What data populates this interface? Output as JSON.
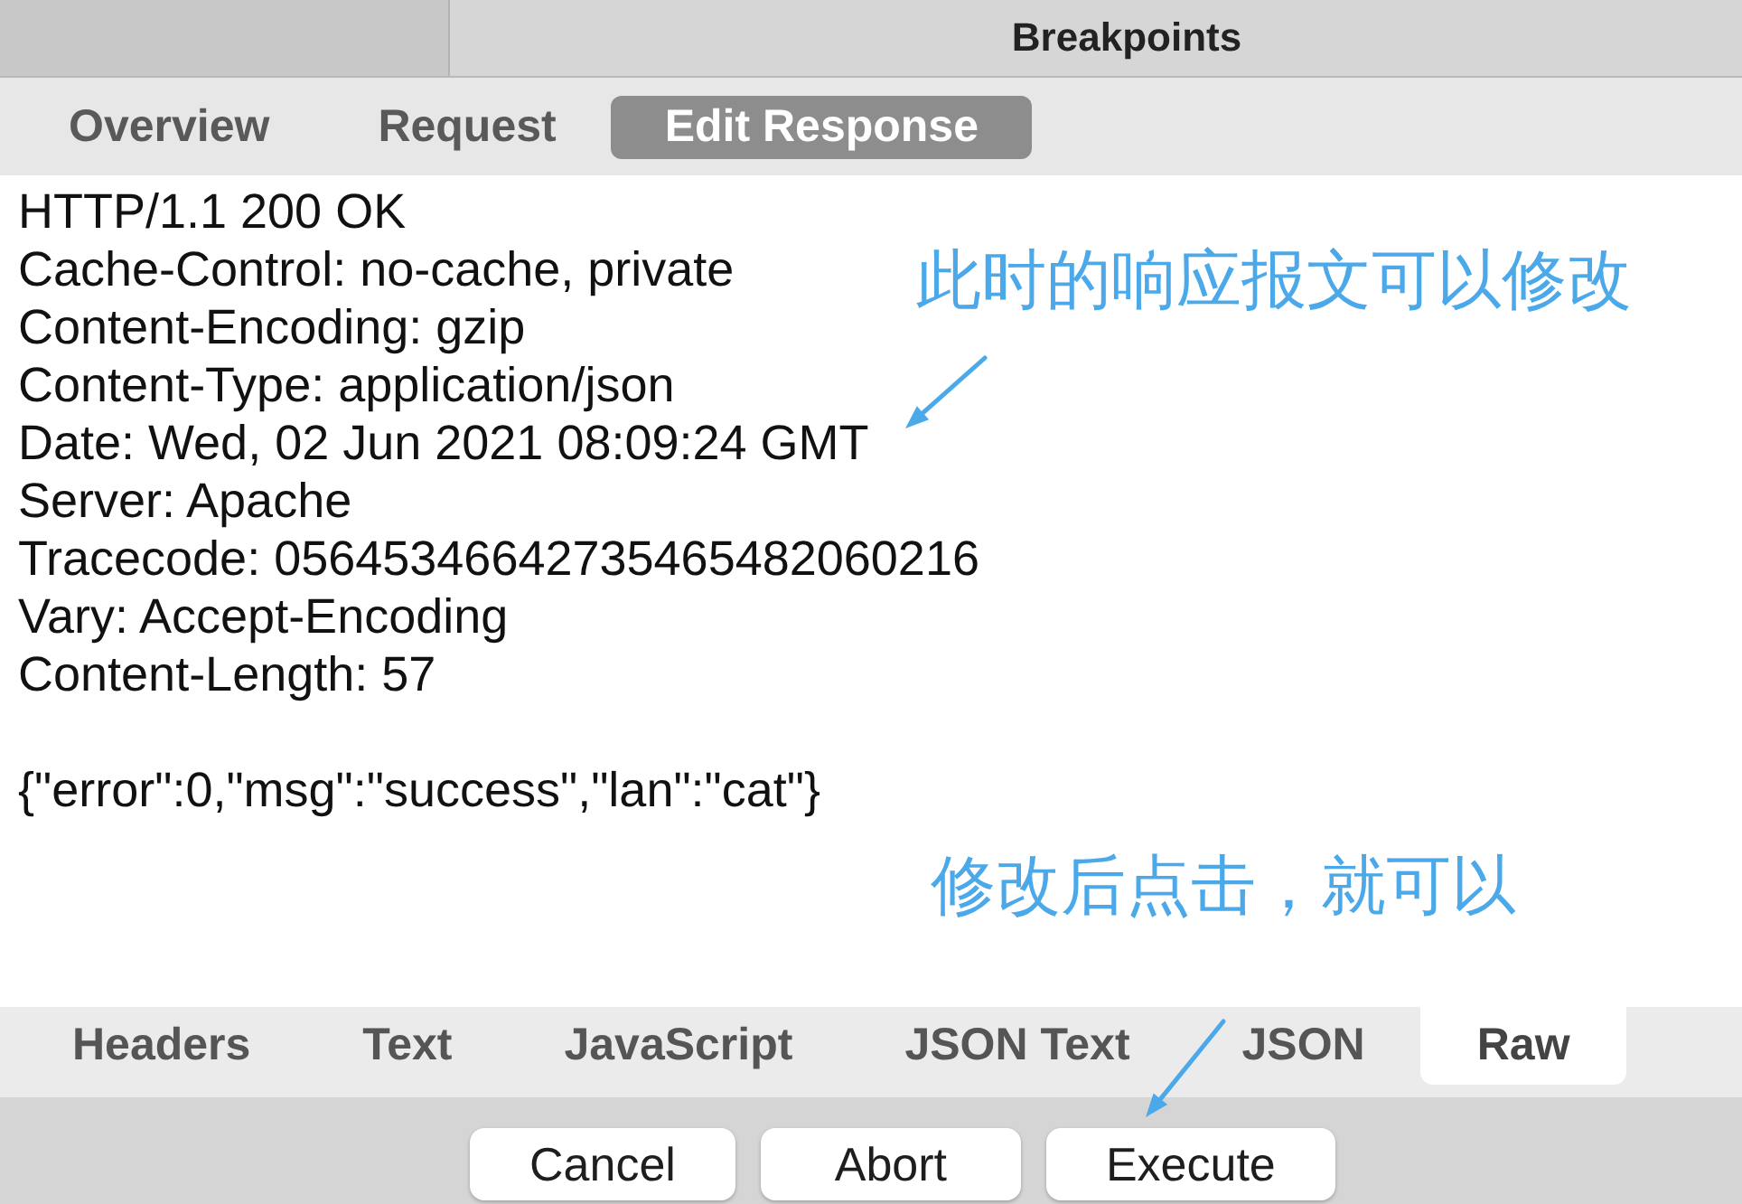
{
  "window": {
    "title": "Breakpoints"
  },
  "tabs": [
    {
      "label": "Overview",
      "selected": false
    },
    {
      "label": "Request",
      "selected": false
    },
    {
      "label": "Edit Response",
      "selected": true
    }
  ],
  "response": {
    "header_lines": [
      "HTTP/1.1 200 OK",
      "Cache-Control: no-cache, private",
      "Content-Encoding: gzip",
      "Content-Type: application/json",
      "Date: Wed, 02 Jun 2021 08:09:24 GMT",
      "Server: Apache",
      "Tracecode: 05645346642735465482060216",
      "Vary: Accept-Encoding",
      "Content-Length: 57"
    ],
    "body": "{\"error\":0,\"msg\":\"success\",\"lan\":\"cat\"}"
  },
  "annotations": [
    {
      "text": "此时的响应报文可以修改"
    },
    {
      "text": "修改后点击，就可以"
    }
  ],
  "view_tabs": [
    {
      "label": "Headers",
      "selected": false
    },
    {
      "label": "Text",
      "selected": false
    },
    {
      "label": "JavaScript",
      "selected": false
    },
    {
      "label": "JSON Text",
      "selected": false
    },
    {
      "label": "JSON",
      "selected": false
    },
    {
      "label": "Raw",
      "selected": true
    }
  ],
  "buttons": [
    {
      "label": "Cancel"
    },
    {
      "label": "Abort"
    },
    {
      "label": "Execute"
    }
  ]
}
